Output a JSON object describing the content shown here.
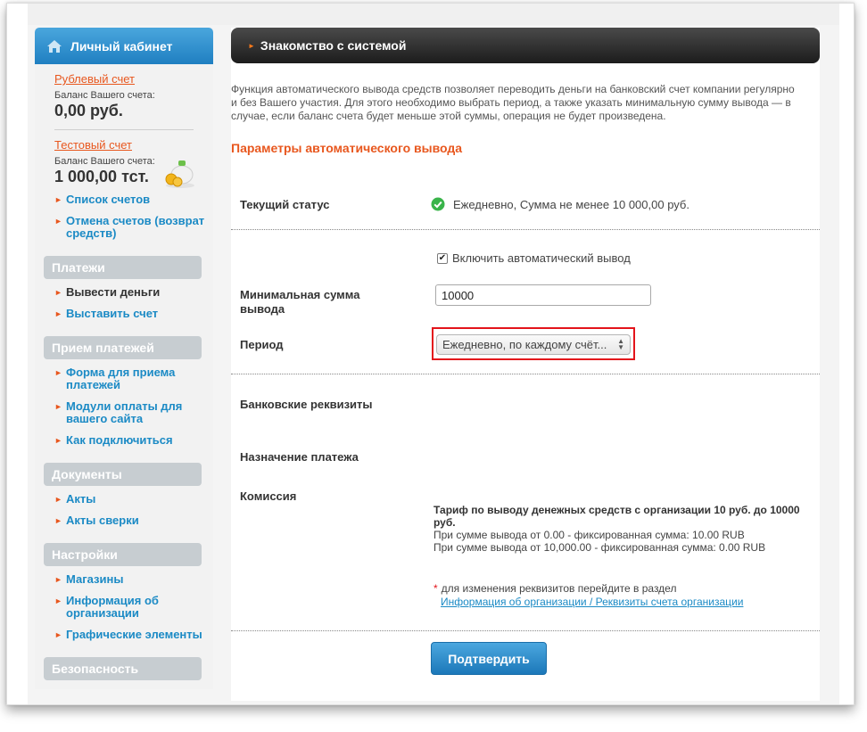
{
  "sidebar": {
    "header": "Личный кабинет",
    "ruble_account": {
      "link": "Рублевый счет",
      "balance_label": "Баланс Вашего счета:",
      "balance": "0,00 руб."
    },
    "test_account": {
      "link": "Тестовый счет",
      "balance_label": "Баланс Вашего счета:",
      "balance": "1 000,00 тст."
    },
    "account_links": [
      "Список счетов",
      "Отмена счетов (возврат средств)"
    ],
    "sections": [
      {
        "title": "Платежи",
        "items": [
          "Вывести деньги",
          "Выставить счет"
        ]
      },
      {
        "title": "Прием платежей",
        "items": [
          "Форма для приема платежей",
          "Модули оплаты для вашего сайта",
          "Как подключиться"
        ]
      },
      {
        "title": "Документы",
        "items": [
          "Акты",
          "Акты сверки"
        ]
      },
      {
        "title": "Настройки",
        "items": [
          "Магазины",
          "Информация об организации",
          "Графические элементы"
        ]
      },
      {
        "title": "Безопасность",
        "items": []
      }
    ],
    "active_item": "Вывести деньги"
  },
  "main": {
    "title": "Знакомство с системой",
    "intro": "Функция автоматического вывода средств позволяет переводить деньги на банковский счет компании регулярно и без Вашего участия. Для этого необходимо выбрать период, а также указать минимальную сумму вывода — в случае, если баланс счета будет меньше этой суммы, операция не будет произведена.",
    "params_heading": "Параметры автоматического вывода",
    "current_status_label": "Текущий статус",
    "current_status_value": "Ежедневно, Сумма не менее 10 000,00 руб.",
    "enable_checkbox_label": "Включить автоматический вывод",
    "enable_checked": true,
    "min_amount_label": "Минимальная сумма вывода",
    "min_amount_value": "10000",
    "period_label": "Период",
    "period_value": "Ежедневно, по каждому счёт...",
    "bank_details_label": "Банковские реквизиты",
    "payment_purpose_label": "Назначение платежа",
    "commission_label": "Комиссия",
    "fee_title": "Тариф по выводу денежных средств с организации 10 руб. до 10000 руб.",
    "fee_lines": [
      "При сумме вывода от 0.00 - фиксированная сумма: 10.00 RUB",
      "При сумме вывода от 10,000.00 - фиксированная сумма: 0.00 RUB"
    ],
    "note_text": "для изменения реквизитов перейдите в раздел",
    "note_link": "Информация об организации / Реквизиты счета организации",
    "confirm_button": "Подтвердить"
  },
  "colors": {
    "accent_orange": "#e8571e",
    "link_blue": "#1b8ac5",
    "header_blue": "#1f7fc1",
    "highlight_red": "#e3141b"
  }
}
